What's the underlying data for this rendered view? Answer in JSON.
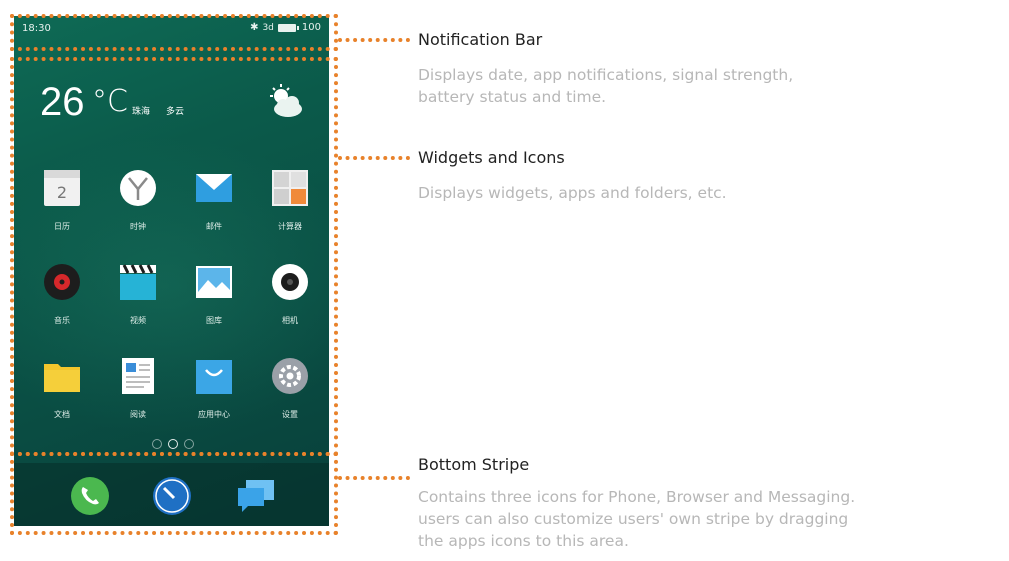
{
  "status_bar": {
    "time": "18:30",
    "bluetooth": "✱",
    "signal": "3d",
    "battery": "100"
  },
  "weather": {
    "temperature": "26",
    "unit": "°C",
    "city": "珠海",
    "condition": "多云",
    "icon": "partly-cloudy-icon"
  },
  "apps": [
    {
      "label": "日历",
      "icon": "calendar-icon",
      "color": "#f1f1f1"
    },
    {
      "label": "时钟",
      "icon": "clock-icon",
      "color": "#ffffff"
    },
    {
      "label": "邮件",
      "icon": "mail-icon",
      "color": "#2f9ee0"
    },
    {
      "label": "计算器",
      "icon": "calculator-icon",
      "color": "#f0f0f0"
    },
    {
      "label": "音乐",
      "icon": "music-icon",
      "color": "#222222"
    },
    {
      "label": "视频",
      "icon": "video-icon",
      "color": "#26b3d6"
    },
    {
      "label": "图库",
      "icon": "gallery-icon",
      "color": "#5cb5ea"
    },
    {
      "label": "相机",
      "icon": "camera-icon",
      "color": "#ffffff"
    },
    {
      "label": "文档",
      "icon": "folder-icon",
      "color": "#f3c62c"
    },
    {
      "label": "阅读",
      "icon": "reader-icon",
      "color": "#ffffff"
    },
    {
      "label": "应用中心",
      "icon": "app-store-icon",
      "color": "#3ba6e6"
    },
    {
      "label": "设置",
      "icon": "settings-icon",
      "color": "#9aa0a8"
    }
  ],
  "dock": [
    {
      "icon": "phone-icon",
      "color": "#4bb84f"
    },
    {
      "icon": "browser-icon",
      "color": "#1f70c4"
    },
    {
      "icon": "messaging-icon",
      "color": "#3aa3e8"
    }
  ],
  "annotations": {
    "notification_bar": {
      "title": "Notification Bar",
      "desc_1": "Displays date, app notifications, signal strength,",
      "desc_2": "battery status and time."
    },
    "widgets": {
      "title": "Widgets and Icons",
      "desc_1": "Displays widgets, apps and folders, etc."
    },
    "bottom_stripe": {
      "title": "Bottom Stripe",
      "desc_1": "Contains three icons for Phone, Browser and Messaging.",
      "desc_2": "users can also customize users' own stripe by dragging",
      "desc_3": "the apps icons to this area."
    }
  },
  "colors": {
    "callout": "#e8822b",
    "title_text": "#222222",
    "desc_text": "#b7b7b7",
    "phone_bg": "#0b5a4a"
  }
}
